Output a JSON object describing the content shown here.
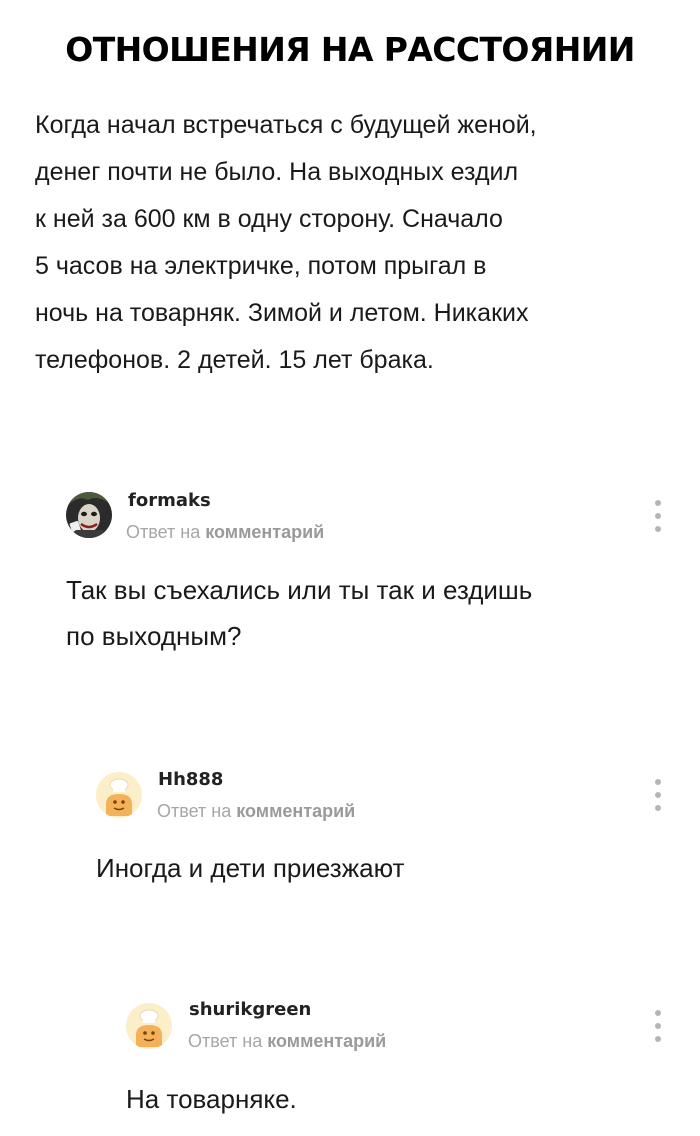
{
  "title": "ОТНОШЕНИЯ НА РАССТОЯНИИ",
  "story": {
    "lines": [
      "Когда начал встречаться с будущей женой,",
      "денег почти не было. На выходных ездил",
      "к ней за 600 км в одну сторону. Сначало",
      "5 часов на электричке, потом прыгал в",
      "ночь на товарняк. Зимой и летом. Никаких",
      "телефонов. 2 детей. 15 лет брака."
    ]
  },
  "comments": [
    {
      "username": "formaks",
      "reply_prefix": "Ответ на",
      "reply_target": "комментарий",
      "avatar_icon": "joker-avatar-icon",
      "text_lines": [
        "Так вы съехались или ты так и ездишь",
        "по выходным?"
      ]
    },
    {
      "username": "Hh888",
      "reply_prefix": "Ответ на",
      "reply_target": "комментарий",
      "avatar_icon": "default-chef-avatar-icon",
      "text_lines": [
        "Иногда и дети приезжают"
      ]
    },
    {
      "username": "shurikgreen",
      "reply_prefix": "Ответ на",
      "reply_target": "комментарий",
      "avatar_icon": "default-chef-avatar-icon",
      "text_lines": [
        "На товарняке."
      ]
    }
  ],
  "colors": {
    "text": "#1a1a1a",
    "meta": "#a6a6a6",
    "kebab": "#b5b5b5",
    "chef_avatar_bg": "#fbeec9",
    "chef_avatar_body": "#f3b25a"
  }
}
